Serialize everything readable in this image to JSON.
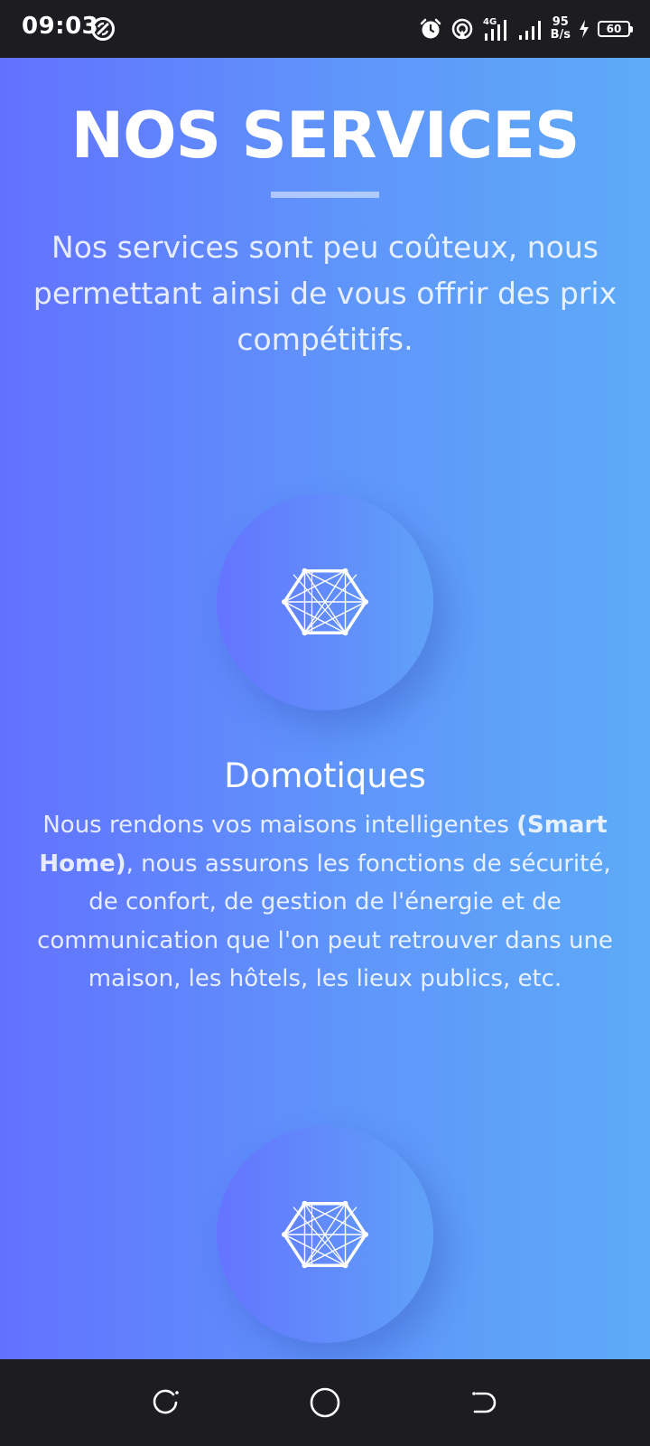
{
  "status_bar": {
    "time": "09:03",
    "left_icon": "auto-sync-icon",
    "icons": [
      "alarm-icon",
      "hotspot-icon",
      "signal-4g-icon",
      "signal-icon",
      "charging-icon"
    ],
    "network_type": "4G",
    "net_speed_value": "95",
    "net_speed_unit": "B/s",
    "battery_level": "60"
  },
  "header": {
    "title": "NOS SERVICES",
    "intro": "Nos services sont peu coûteux, nous permettant ainsi de vous offrir des prix compétitifs."
  },
  "services": [
    {
      "icon": "hexagon-network-icon",
      "title": "Domotiques",
      "desc_before": "Nous rendons vos maisons intelligentes ",
      "desc_bold": "(Smart Home)",
      "desc_after": ", nous assurons les fonctions de sécurité, de confort, de gestion de l'énergie et de communication que l'on peut retrouver dans une maison, les hôtels, les lieux publics, etc."
    },
    {
      "icon": "hexagon-network-icon"
    }
  ],
  "nav_bar": {
    "buttons": [
      "recent-apps-icon",
      "home-icon",
      "back-icon"
    ]
  },
  "colors": {
    "gradient_start": "#6272ff",
    "gradient_end": "#5eaaf8",
    "system_bar": "#1c1c21",
    "text": "#ffffff"
  }
}
